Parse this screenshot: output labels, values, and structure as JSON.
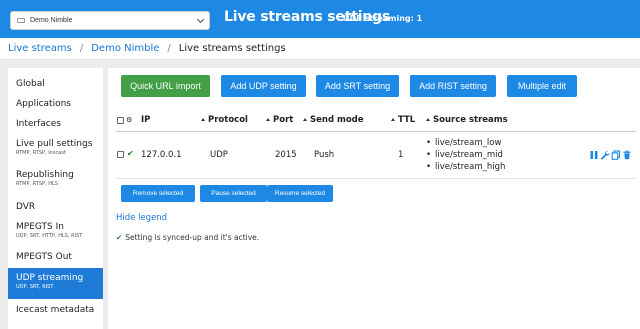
{
  "header": {
    "server_name": "Demo Nimble",
    "title": "Live streams settings",
    "status": "UDP streaming: 1"
  },
  "breadcrumb": [
    "Live streams",
    "Demo Nimble",
    "Live streams settings"
  ],
  "sidebar": {
    "items": [
      {
        "label": "Global",
        "sub": ""
      },
      {
        "label": "Applications",
        "sub": ""
      },
      {
        "label": "Interfaces",
        "sub": ""
      },
      {
        "label": "Live pull settings",
        "sub": "RTMP, RTSP, Icecast"
      },
      {
        "label": "Republishing",
        "sub": "RTMP, RTSP, HLS"
      },
      {
        "label": "DVR",
        "sub": ""
      },
      {
        "label": "MPEGTS In",
        "sub": "UDP, SRT, HTTP, HLS, RIST"
      },
      {
        "label": "MPEGTS Out",
        "sub": ""
      },
      {
        "label": "UDP streaming",
        "sub": "UDP, SRT, RIST",
        "active": true
      },
      {
        "label": "Icecast metadata",
        "sub": ""
      }
    ]
  },
  "toolbar": {
    "quick_url": "Quick URL import",
    "add_udp": "Add UDP setting",
    "add_srt": "Add SRT setting",
    "add_rist": "Add RIST setting",
    "multiple_edit": "Multiple edit"
  },
  "table": {
    "headers": {
      "ip": "IP",
      "protocol": "Protocol",
      "port": "Port",
      "send_mode": "Send mode",
      "ttl": "TTL",
      "source": "Source streams"
    },
    "rows": [
      {
        "ip": "127.0.0.1",
        "protocol": "UDP",
        "port": "2015",
        "send_mode": "Push",
        "ttl": "1",
        "streams": [
          "live/stream_low",
          "live/stream_mid",
          "live/stream_high"
        ]
      }
    ]
  },
  "selection": {
    "remove": "Remove selected",
    "pause": "Pause selected",
    "resume": "Resume selected"
  },
  "legend": {
    "toggle": "Hide legend",
    "synced_text": "Setting is synced-up and it's active."
  },
  "colors": {
    "accent": "#1e88e5",
    "active": "#1e7bd8",
    "success": "#43a047"
  }
}
